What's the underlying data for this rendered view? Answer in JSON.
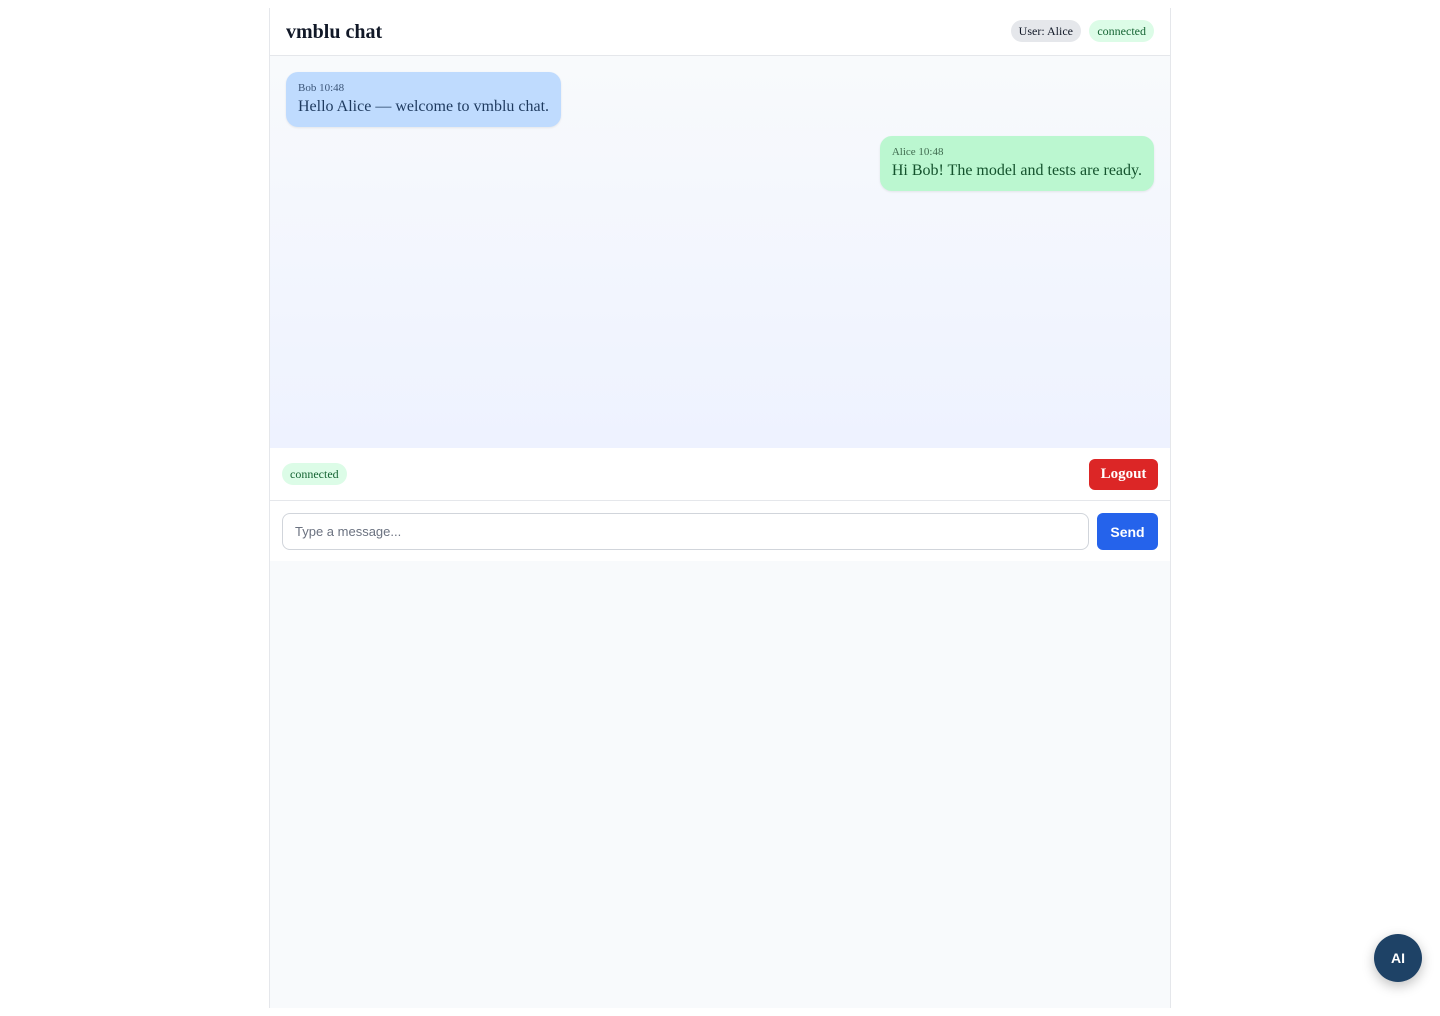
{
  "header": {
    "title": "vmblu chat",
    "user_badge": "User: Alice",
    "status_badge": "connected"
  },
  "messages": [
    {
      "sender": "Bob",
      "time": "10:48",
      "meta": "Bob 10:48",
      "text": "Hello Alice — welcome to vmblu chat."
    },
    {
      "sender": "Alice",
      "time": "10:48",
      "meta": "Alice 10:48",
      "text": "Hi Bob! The model and tests are ready."
    }
  ],
  "statusbar": {
    "status_badge": "connected",
    "logout_label": "Logout"
  },
  "composer": {
    "placeholder": "Type a message...",
    "value": "",
    "send_label": "Send"
  },
  "assistant": {
    "label": "AI"
  },
  "colors": {
    "accent_blue": "#2563eb",
    "danger_red": "#dc2626",
    "incoming_bubble": "#bfdbfe",
    "outgoing_bubble": "#bbf7d0",
    "connected_badge": "#dcfce7",
    "ai_button": "#1e4266"
  }
}
